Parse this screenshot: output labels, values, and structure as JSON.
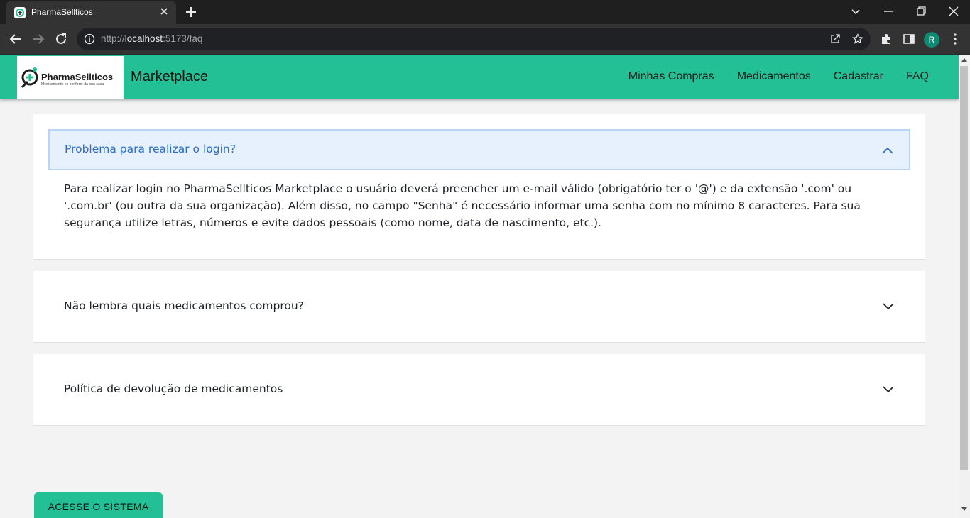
{
  "browser": {
    "tab_title": "PharmaSellticos",
    "url_prefix": "http://",
    "url_host": "localhost",
    "url_path": ":5173/faq",
    "profile_initial": "R"
  },
  "navbar": {
    "logo_text": "PharmaSellticos",
    "logo_tagline": "Medicamento no conforto da sua casa",
    "brand": "Marketplace",
    "links": [
      "Minhas Compras",
      "Medicamentos",
      "Cadastrar",
      "FAQ"
    ]
  },
  "faq": [
    {
      "question": "Problema para realizar o login?",
      "expanded": true,
      "answer": "Para realizar login no PharmaSellticos Marketplace o usuário deverá preencher um e-mail válido (obrigatório ter o '@') e da extensão '.com' ou '.com.br' (ou outra da sua organização). Além disso, no campo \"Senha\" é necessário informar uma senha com no mínimo 8 caracteres. Para sua segurança utilize letras, números e evite dados pessoais (como nome, data de nascimento, etc.)."
    },
    {
      "question": "Não lembra quais medicamentos comprou?",
      "expanded": false
    },
    {
      "question": "Política de devolução de medicamentos",
      "expanded": false
    }
  ],
  "cta_label": "ACESSE O SISTEMA",
  "colors": {
    "navbar": "#22c094",
    "accordion_active_bg": "#e7f1fd",
    "accordion_active_text": "#2c6dc4"
  }
}
